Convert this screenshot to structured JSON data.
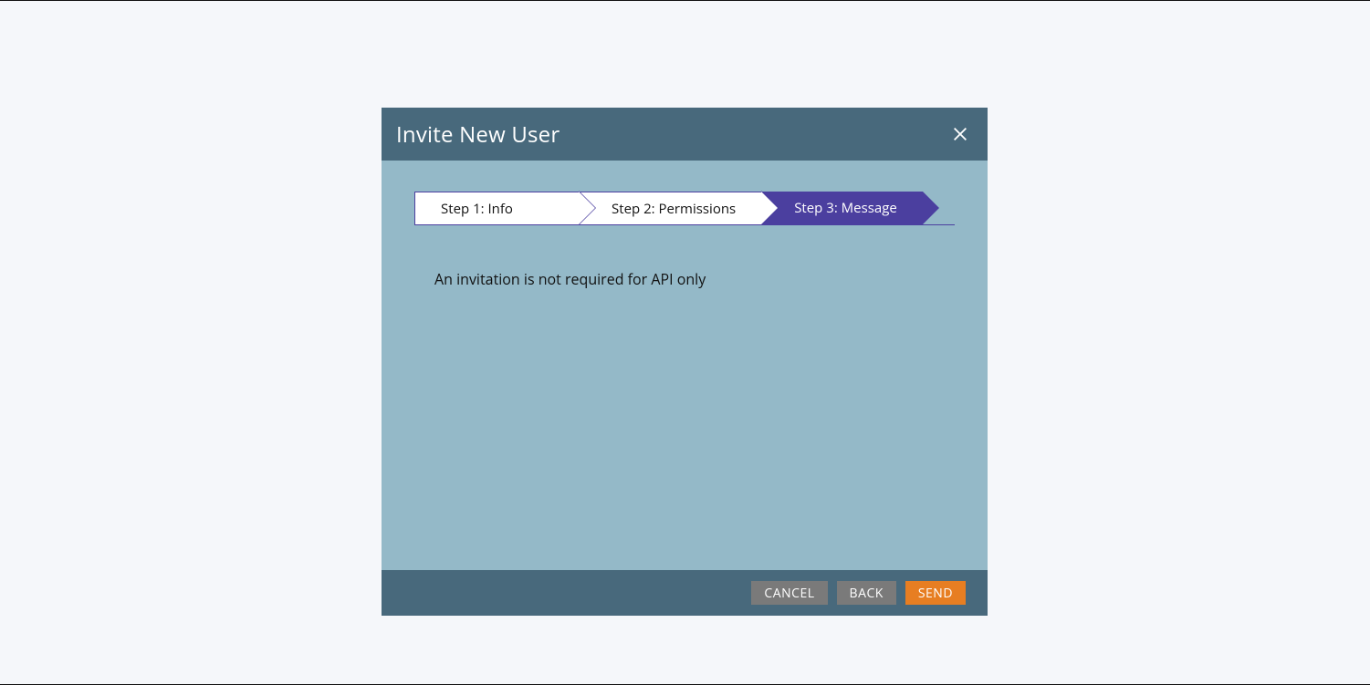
{
  "modal": {
    "title": "Invite New User"
  },
  "wizard": {
    "steps": [
      {
        "label": "Step 1: Info",
        "active": false
      },
      {
        "label": "Step 2: Permissions",
        "active": false
      },
      {
        "label": "Step 3: Message",
        "active": true
      }
    ]
  },
  "body": {
    "message": "An invitation is not required for API only"
  },
  "footer": {
    "cancel_label": "CANCEL",
    "back_label": "BACK",
    "send_label": "SEND"
  }
}
